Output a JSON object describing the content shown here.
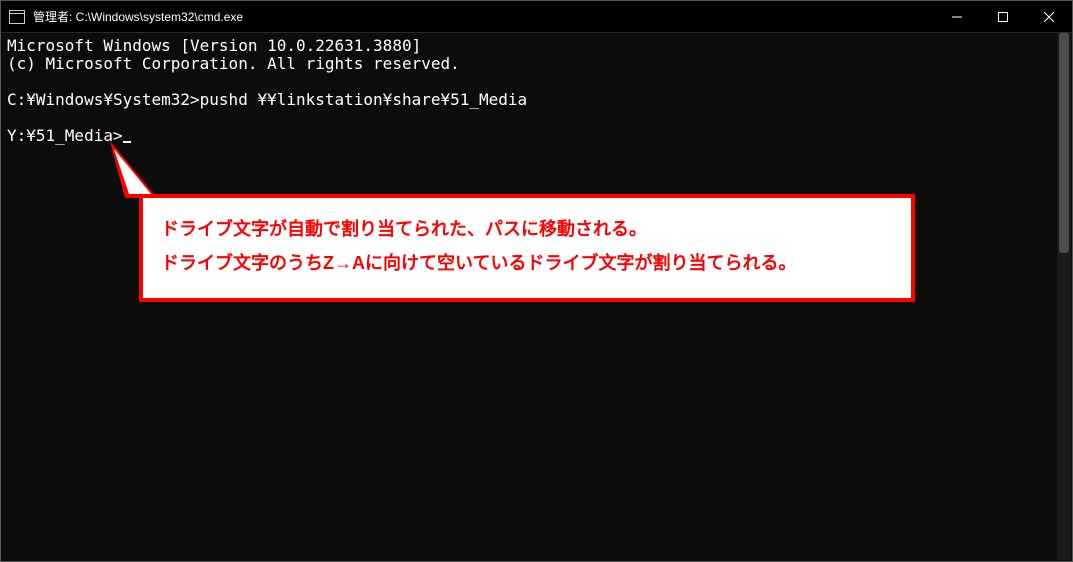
{
  "window": {
    "title": "管理者: C:\\Windows\\system32\\cmd.exe"
  },
  "terminal": {
    "line1": "Microsoft Windows [Version 10.0.22631.3880]",
    "line2": "(c) Microsoft Corporation. All rights reserved.",
    "line3": "",
    "prompt1_path": "C:¥Windows¥System32>",
    "prompt1_cmd": "pushd ¥¥linkstation¥share¥51_Media",
    "line5": "",
    "prompt2_path": "Y:¥51_Media>"
  },
  "callout": {
    "line1": "ドライブ文字が自動で割り当てられた、パスに移動される。",
    "line2": "ドライブ文字のうちZ→Aに向けて空いているドライブ文字が割り当てられる。"
  }
}
